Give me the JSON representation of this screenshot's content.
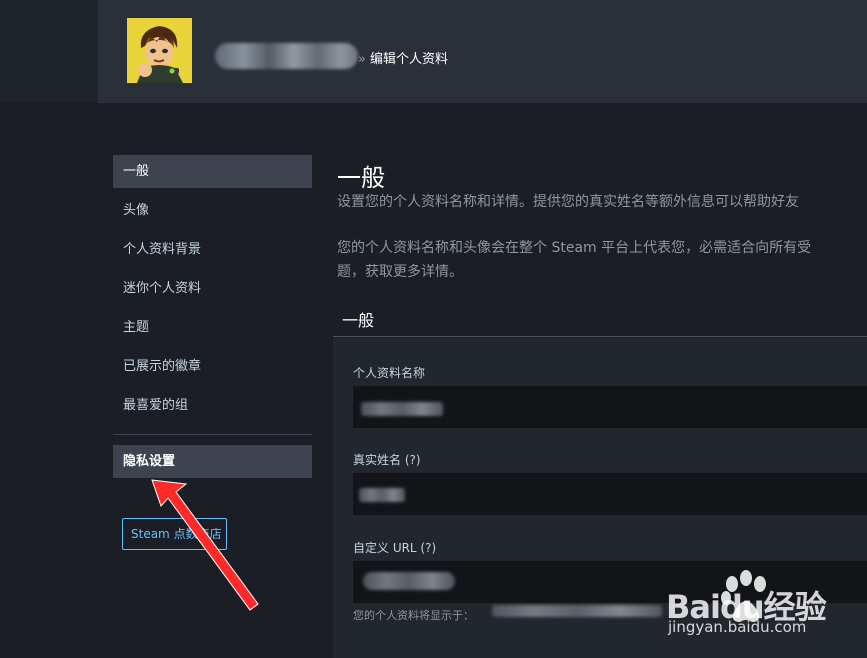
{
  "header": {
    "separator": "»",
    "breadcrumb_current": "编辑个人资料"
  },
  "sidebar": {
    "items": [
      {
        "label": "一般",
        "active": true
      },
      {
        "label": "头像"
      },
      {
        "label": "个人资料背景"
      },
      {
        "label": "迷你个人资料"
      },
      {
        "label": "主题"
      },
      {
        "label": "已展示的徽章"
      },
      {
        "label": "最喜爱的组"
      }
    ],
    "privacy_label": "隐私设置",
    "points_button_label": "Steam 点数商店"
  },
  "main": {
    "title": "一般",
    "description_1": "设置您的个人资料名称和详情。提供您的真实姓名等额外信息可以帮助好友",
    "description_2a": "您的个人资料名称和头像会在整个 Steam 平台上代表您，必需适合向所有受",
    "description_2b": "题，获取更多详情。",
    "section_title": "一般",
    "fields": {
      "profile_name_label": "个人资料名称",
      "real_name_label": "真实姓名 (?)",
      "custom_url_label": "自定义 URL (?)"
    },
    "profile_url_hint": "您的个人资料将显示于："
  },
  "watermark": {
    "brand": "Baidu经验",
    "url": "jingyan.baidu.com"
  },
  "colors": {
    "accent": "#67c1f5",
    "annotation_arrow": "#ff2a2a"
  }
}
